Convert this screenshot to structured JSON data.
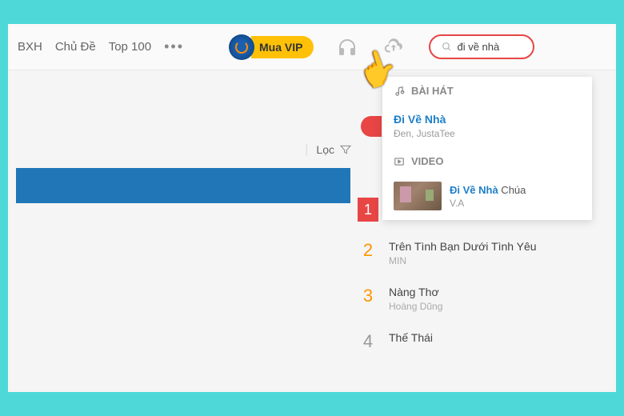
{
  "nav": {
    "items": [
      "BXH",
      "Chủ Đề",
      "Top 100"
    ]
  },
  "vip": {
    "label": "Mua VIP"
  },
  "search": {
    "query": "đi về nhà"
  },
  "dropdown": {
    "section_song": "BÀI HÁT",
    "section_video": "VIDEO",
    "song": {
      "title": "Đi Về Nhà",
      "artist": "Đen, JustaTee"
    },
    "video": {
      "title_bold": "Đi Về Nhà",
      "title_rest": " Chúa",
      "artist": "V.A"
    }
  },
  "filter": {
    "label": "Lọc"
  },
  "chart": {
    "items": [
      {
        "rank": "1",
        "title": "",
        "artist": ""
      },
      {
        "rank": "2",
        "title": "Trên Tình Bạn Dưới Tình Yêu",
        "artist": "MIN"
      },
      {
        "rank": "3",
        "title": "Nàng Thơ",
        "artist": "Hoàng Dũng"
      },
      {
        "rank": "4",
        "title": "Thế Thái",
        "artist": ""
      }
    ]
  }
}
